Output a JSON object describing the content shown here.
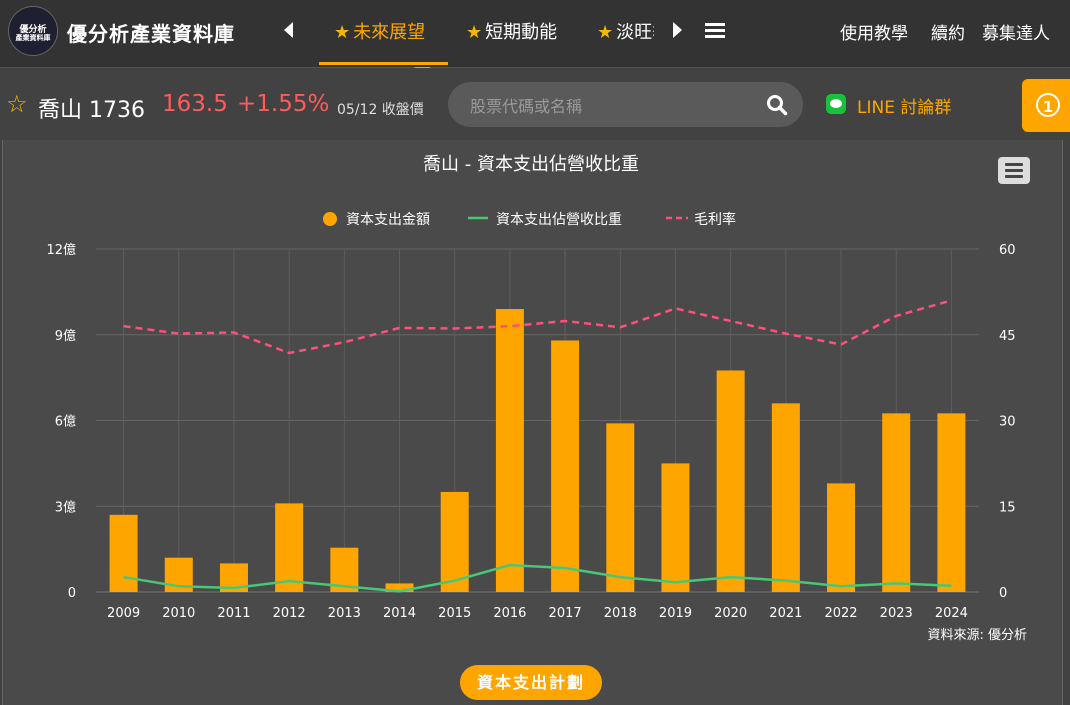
{
  "app": {
    "logo_text_1": "優分析",
    "logo_text_2": "產業資料庫",
    "title": "優分析產業資料庫"
  },
  "nav": {
    "tabs": [
      {
        "label": "未來展望",
        "active": true
      },
      {
        "label": "短期動能",
        "active": false
      },
      {
        "label": "淡旺季",
        "active": false
      }
    ],
    "links": [
      "使用教學",
      "續約",
      "募集達人"
    ]
  },
  "stock": {
    "name_code": "喬山 1736",
    "price": "163.5",
    "change": "+1.55%",
    "date": "05/12 收盤價"
  },
  "search": {
    "placeholder": "股票代碼或名稱"
  },
  "line_group": {
    "label": "LINE 討論群"
  },
  "notification": {
    "count": "1"
  },
  "colors": {
    "accent": "#ffa500",
    "up": "#ff5b5b",
    "line_green": "#48c774",
    "margin_pink": "#ff4f7b"
  },
  "chart_data": {
    "type": "bar",
    "title": "喬山 - 資本支出佔營收比重",
    "source": "資料來源: 優分析",
    "categories": [
      "2009",
      "2010",
      "2011",
      "2012",
      "2013",
      "2014",
      "2015",
      "2016",
      "2017",
      "2018",
      "2019",
      "2020",
      "2021",
      "2022",
      "2023",
      "2024"
    ],
    "left_axis": {
      "min": 0,
      "max": 12,
      "ticks": [
        0,
        3,
        6,
        9,
        12
      ],
      "tick_labels": [
        "0",
        "3億",
        "6億",
        "9億",
        "12億"
      ]
    },
    "right_axis": {
      "min": 0,
      "max": 60,
      "ticks": [
        0,
        15,
        30,
        45,
        60
      ],
      "tick_labels": [
        "0",
        "15",
        "30",
        "45",
        "60"
      ]
    },
    "grid": true,
    "legend_position": "top",
    "series": [
      {
        "name": "資本支出金額",
        "type": "bar",
        "axis": "left",
        "color": "#ffa500",
        "values": [
          2.7,
          1.2,
          1.0,
          3.1,
          1.55,
          0.3,
          3.5,
          9.9,
          8.8,
          5.9,
          4.5,
          7.75,
          6.6,
          3.8,
          6.25,
          6.25
        ]
      },
      {
        "name": "資本支出佔營收比重",
        "type": "line",
        "axis": "right",
        "color": "#48c774",
        "values": [
          2.6,
          1.0,
          0.7,
          1.9,
          1.0,
          0.1,
          2.0,
          4.7,
          4.2,
          2.6,
          1.7,
          2.6,
          2.0,
          1.0,
          1.5,
          1.1
        ]
      },
      {
        "name": "毛利率",
        "type": "line",
        "dashed": true,
        "axis": "right",
        "color": "#ff4f7b",
        "values": [
          46.5,
          45.2,
          45.4,
          41.8,
          43.7,
          46.2,
          46.1,
          46.5,
          47.4,
          46.3,
          49.6,
          47.4,
          45.2,
          43.3,
          48.3,
          51.0
        ]
      }
    ]
  },
  "capex_button": {
    "label": "資本支出計劃"
  }
}
